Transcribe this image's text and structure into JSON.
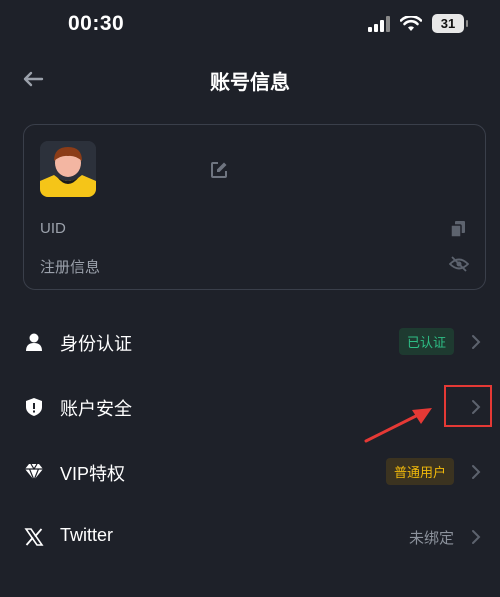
{
  "status_bar": {
    "time": "00:30",
    "battery": "31"
  },
  "nav": {
    "title": "账号信息",
    "back_icon": "back-arrow-icon"
  },
  "profile_card": {
    "avatar_icon": "avatar-icon",
    "edit_icon": "edit-icon",
    "uid_label": "UID",
    "registration_label": "注册信息",
    "copy_icon": "copy-icon",
    "visibility_icon": "eye-hidden-icon"
  },
  "menu": {
    "identity": {
      "label": "身份认证",
      "badge": "已认证",
      "icon": "user-icon"
    },
    "security": {
      "label": "账户安全",
      "icon": "shield-icon"
    },
    "vip": {
      "label": "VIP特权",
      "badge": "普通用户",
      "icon": "diamond-icon"
    },
    "twitter": {
      "label": "Twitter",
      "status": "未绑定",
      "icon": "x-logo-icon"
    }
  },
  "colors": {
    "background": "#1e2129",
    "verified_green": "#2ebd85",
    "vip_gold": "#f0b90b",
    "annotation_red": "#e53935"
  }
}
